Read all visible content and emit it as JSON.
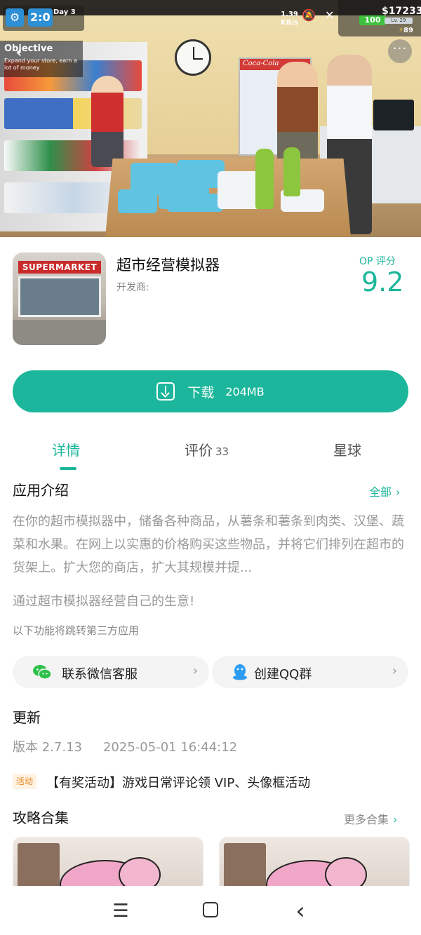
{
  "hero": {
    "hud_time": "2:0",
    "hud_day": "Day 3",
    "objective_title": "Objective",
    "objective_desc": "Expand your store, earn a lot of money",
    "net_speed": "1.39",
    "net_unit": "KB/s",
    "money": "$17233",
    "battery": "100",
    "level": "Lv. 29",
    "energy": "89",
    "fridge_brand": "Coca-Cola",
    "more_label": "···"
  },
  "app": {
    "icon_sign": "SUPERMARKET",
    "name": "超市经营模拟器",
    "developer_label": "开发商:",
    "score_label": "OP 评分",
    "score_value": "9.2",
    "download_label": "下载",
    "download_size": "204MB"
  },
  "tabs": [
    {
      "label": "详情",
      "count": ""
    },
    {
      "label": "评价",
      "count": "33"
    },
    {
      "label": "星球",
      "count": ""
    }
  ],
  "intro": {
    "title": "应用介绍",
    "more_label": "全部",
    "description": "在你的超市模拟器中，储备各种商品，从薯条和薯条到肉类、汉堡、蔬菜和水果。在网上以实惠的价格购买这些物品，并将它们排列在超市的货架上。扩大您的商店，扩大其规模并提...",
    "tagline": "通过超市模拟器经营自己的生意!",
    "third_party_note": "以下功能将跳转第三方应用"
  },
  "contacts": [
    {
      "label": "联系微信客服",
      "icon": "wechat-icon"
    },
    {
      "label": "创建QQ群",
      "icon": "qq-icon"
    }
  ],
  "update": {
    "title": "更新",
    "version": "版本 2.7.13",
    "timestamp": "2025-05-01 16:44:12"
  },
  "activity": {
    "tag": "活动",
    "text": "【有奖活动】游戏日常评论领 VIP、头像框活动"
  },
  "guides": {
    "title": "攻略合集",
    "more_label": "更多合集"
  },
  "colors": {
    "accent": "#1bb69b",
    "activity_tag_bg": "#fff2e2",
    "activity_tag_text": "#e88a2a"
  }
}
